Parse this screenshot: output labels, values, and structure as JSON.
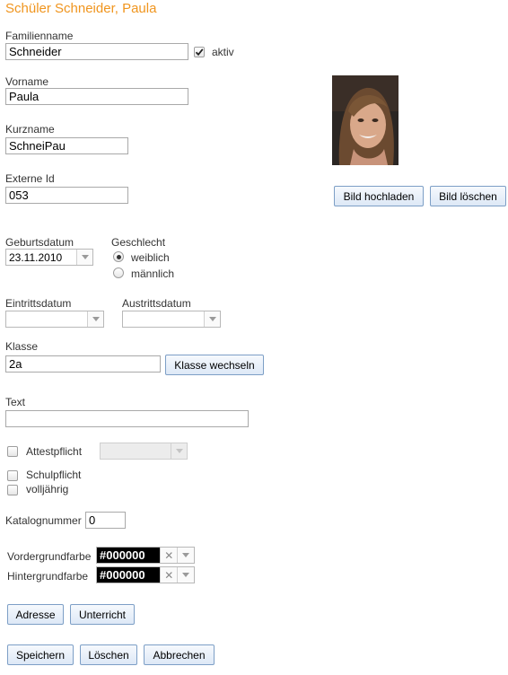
{
  "title": "Schüler Schneider, Paula",
  "familienname": {
    "label": "Familienname",
    "value": "Schneider",
    "aktiv_label": "aktiv",
    "aktiv_checked": true
  },
  "vorname": {
    "label": "Vorname",
    "value": "Paula"
  },
  "kurzname": {
    "label": "Kurzname",
    "value": "SchneiPau"
  },
  "externe_id": {
    "label": "Externe Id",
    "value": "053"
  },
  "photo_buttons": {
    "upload": "Bild hochladen",
    "delete": "Bild löschen"
  },
  "geburtsdatum": {
    "label": "Geburtsdatum",
    "value": "23.11.2010"
  },
  "geschlecht": {
    "label": "Geschlecht",
    "options": [
      "weiblich",
      "männlich"
    ],
    "selected": "weiblich"
  },
  "eintrittsdatum": {
    "label": "Eintrittsdatum",
    "value": ""
  },
  "austrittsdatum": {
    "label": "Austrittsdatum",
    "value": ""
  },
  "klasse": {
    "label": "Klasse",
    "value": "2a",
    "change_button": "Klasse wechseln"
  },
  "text": {
    "label": "Text",
    "value": ""
  },
  "attestpflicht": {
    "label": "Attestpflicht",
    "checked": false,
    "select_value": ""
  },
  "schulpflicht": {
    "label": "Schulpflicht",
    "checked": false
  },
  "volljaehrig": {
    "label": "volljährig",
    "checked": false
  },
  "katalognummer": {
    "label": "Katalognummer",
    "value": "0"
  },
  "vordergrundfarbe": {
    "label": "Vordergrundfarbe",
    "value": "#000000"
  },
  "hintergrundfarbe": {
    "label": "Hintergrundfarbe",
    "value": "#000000"
  },
  "sub_buttons": {
    "adresse": "Adresse",
    "unterricht": "Unterricht"
  },
  "actions": {
    "save": "Speichern",
    "delete": "Löschen",
    "cancel": "Abbrechen"
  },
  "colors": {
    "title": "#f0951e",
    "button_border": "#7d9fc6",
    "color_swatch": "#000000"
  },
  "icons": {
    "checkmark": "check-icon",
    "dropdown": "chevron-down-icon",
    "clear": "clear-x-icon"
  }
}
